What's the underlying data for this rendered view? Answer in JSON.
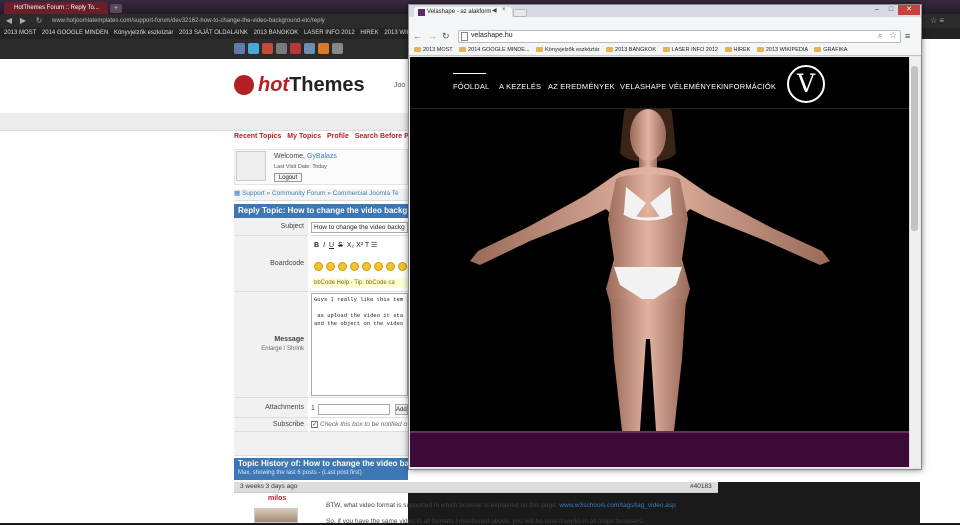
{
  "back_window": {
    "tab_title": "HotThemes Forum :: Reply To...",
    "url": "www.hotjoomlatemplates.com/support-forum/dev32162-how-to-change-the-video-background-etc/reply",
    "bookmarks": [
      "2013 MOST",
      "2014 GOOGLE MINDEN",
      "Könyvjelzők eszköztár",
      "2013 SAJÁT OLDALAINK",
      "2013 BANGKOK",
      "LASER INFO 2012",
      "HIREK",
      "2013 WIKIPEDIA"
    ]
  },
  "forum": {
    "logo_hot": "hot",
    "logo_themes": "Themes",
    "top_nav_partial": "Joo",
    "nav_links": [
      "Recent Topics",
      "My Topics",
      "Profile",
      "Search Before Post"
    ],
    "welcome": "Welcome,",
    "username": "GyBalazs",
    "last_visit": "Last Visit Date: Today",
    "logout": "Logout",
    "breadcrumb": "Support  »  Community Forum  »  Commercial Joomla Te",
    "reply_title": "Reply Topic: How to change the video backg",
    "subject_label": "Subject",
    "subject_value": "How to change the video backg",
    "boardcode_label": "Boardcode",
    "bb_help": "bbCode Help - Tip: bbCode ca",
    "message_label": "Message",
    "enlarge_shrink": "Enlarge /  Shrink",
    "message_text": "Guys I really like this tem\n\n as upload the video it sta\nand the object on the video",
    "attachments_label": "Attachments",
    "attach_num": "1",
    "attach_btn": "Add",
    "subscribe_label": "Subscribe",
    "subscribe_text": "Check this box to be notified o",
    "history_title": "Topic History of: How to change the video ba",
    "history_sub": "Max. showing the last 6 posts  -  (Last post first)",
    "post_date": "3 weeks 3 days ago",
    "post_id": "#40183",
    "post_user": "milos",
    "post_line1_pre": "BTW, what video format is supported in which browser is explained on this page: ",
    "post_line1_link": "www.w3schools.com/tags/tag_video.asp",
    "post_line2": "So, if you have the same video in all formats I mentioned above, you will be sure it works in all major browsers."
  },
  "front_window": {
    "tab_title": "Velashape - az alakform",
    "url": "velashape.hu",
    "bookmarks": [
      "2013 MOST",
      "2014 GOOGLE MINDE...",
      "Könyvjelzők eszköztár",
      "2013 BANGKOK",
      "LASER INFO 2012",
      "HIREK",
      "2013 WIKIPEDIA",
      "GRAFIKA"
    ],
    "nav": [
      "FŐOLDAL",
      "A KEZELÉS",
      "AZ EREDMÉNYEK",
      "VELASHAPE VÉLEMÉNYEK",
      "INFORMÁCIÓK"
    ],
    "logo_letter": "V",
    "colors": {
      "footer": "#3c0a37",
      "close": "#c7403a"
    }
  }
}
